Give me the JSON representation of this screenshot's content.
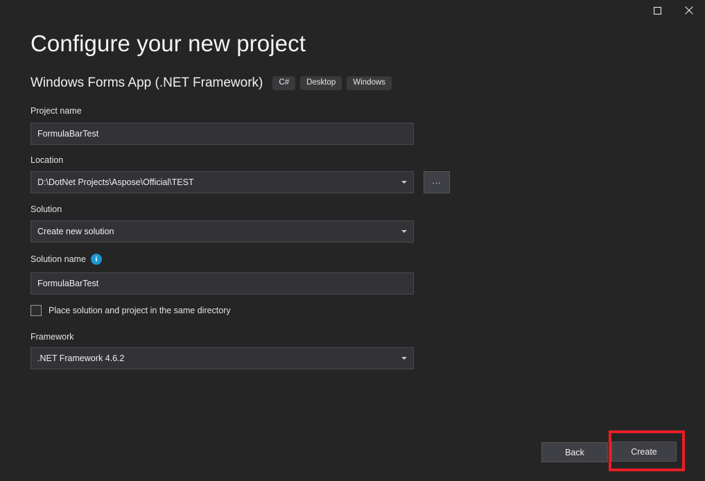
{
  "window": {
    "controls": [
      {
        "name": "maximize-button",
        "icon": "maximize-icon",
        "label": "Maximize"
      },
      {
        "name": "close-button",
        "icon": "close-icon",
        "label": "Close"
      }
    ]
  },
  "header": {
    "title": "Configure your new project",
    "subtitle": "Windows Forms App (.NET Framework)",
    "tags": [
      "C#",
      "Desktop",
      "Windows"
    ]
  },
  "form": {
    "project_name": {
      "label": "Project name",
      "value": "FormulaBarTest",
      "placeholder": ""
    },
    "location": {
      "label": "Location",
      "value": "D:\\DotNet Projects\\Aspose\\Official\\TEST",
      "browse_label": "..."
    },
    "solution": {
      "label": "Solution",
      "value": "Create new solution"
    },
    "solution_name": {
      "label": "Solution name",
      "info_icon": "info-icon",
      "value": "FormulaBarTest",
      "placeholder": ""
    },
    "same_directory": {
      "label": "Place solution and project in the same directory",
      "checked": false
    },
    "framework": {
      "label": "Framework",
      "value": ".NET Framework 4.6.2"
    }
  },
  "footer": {
    "back_label": "Back",
    "create_label": "Create"
  },
  "annotation": {
    "highlight_color": "#ec1c24",
    "target": "create-button"
  },
  "colors": {
    "background": "#252526",
    "field_background": "#333337",
    "button_background": "#3f3f46",
    "accent_info": "#1c97d4",
    "text_primary": "#f1f1f1"
  }
}
